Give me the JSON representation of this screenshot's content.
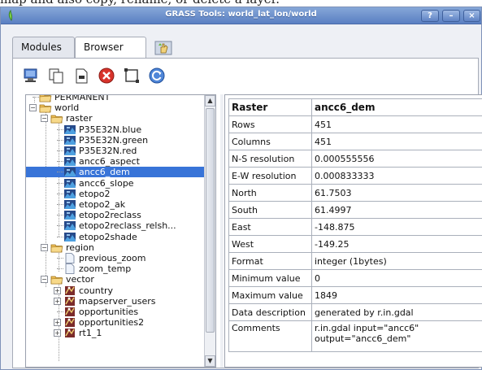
{
  "caption": "map and also copy, rename, or delete a layer.",
  "window": {
    "title": "GRASS Tools: world_lat_lon/world",
    "buttons": [
      "?",
      "–",
      "×"
    ]
  },
  "tabs": [
    {
      "label": "Modules",
      "active": false
    },
    {
      "label": "Browser",
      "active": true
    }
  ],
  "toolbar": {
    "icons": [
      "open-in-qgis-icon",
      "copy-map-icon",
      "rename-map-icon",
      "delete-map-icon",
      "set-region-icon",
      "refresh-icon"
    ]
  },
  "tree": {
    "nodes": [
      {
        "label": "PERMANENT",
        "level": 0,
        "icon": "folder",
        "expander": "none"
      },
      {
        "label": "world",
        "level": 0,
        "icon": "folder",
        "expander": "minus"
      },
      {
        "label": "raster",
        "level": 1,
        "icon": "folder",
        "expander": "minus"
      },
      {
        "label": "P35E32N.blue",
        "level": 2,
        "icon": "raster"
      },
      {
        "label": "P35E32N.green",
        "level": 2,
        "icon": "raster"
      },
      {
        "label": "P35E32N.red",
        "level": 2,
        "icon": "raster"
      },
      {
        "label": "ancc6_aspect",
        "level": 2,
        "icon": "raster"
      },
      {
        "label": "ancc6_dem",
        "level": 2,
        "icon": "raster",
        "selected": true
      },
      {
        "label": "ancc6_slope",
        "level": 2,
        "icon": "raster"
      },
      {
        "label": "etopo2",
        "level": 2,
        "icon": "raster"
      },
      {
        "label": "etopo2_ak",
        "level": 2,
        "icon": "raster"
      },
      {
        "label": "etopo2reclass",
        "level": 2,
        "icon": "raster"
      },
      {
        "label": "etopo2reclass_relsh...",
        "level": 2,
        "icon": "raster"
      },
      {
        "label": "etopo2shade",
        "level": 2,
        "icon": "raster"
      },
      {
        "label": "region",
        "level": 1,
        "icon": "folder",
        "expander": "minus"
      },
      {
        "label": "previous_zoom",
        "level": 2,
        "icon": "file"
      },
      {
        "label": "zoom_temp",
        "level": 2,
        "icon": "file"
      },
      {
        "label": "vector",
        "level": 1,
        "icon": "folder",
        "expander": "minus"
      },
      {
        "label": "country",
        "level": 2,
        "icon": "vector",
        "expander": "plus"
      },
      {
        "label": "mapserver_users",
        "level": 2,
        "icon": "vector",
        "expander": "plus"
      },
      {
        "label": "opportunities",
        "level": 2,
        "icon": "vector"
      },
      {
        "label": "opportunities2",
        "level": 2,
        "icon": "vector",
        "expander": "plus"
      },
      {
        "label": "rt1_1",
        "level": 2,
        "icon": "vector",
        "expander": "plus"
      }
    ]
  },
  "info": {
    "header": {
      "key": "Raster",
      "value": "ancc6_dem"
    },
    "rows": [
      {
        "key": "Rows",
        "value": "451"
      },
      {
        "key": "Columns",
        "value": "451"
      },
      {
        "key": "N-S resolution",
        "value": "0.000555556"
      },
      {
        "key": "E-W resolution",
        "value": "0.000833333"
      },
      {
        "key": "North",
        "value": "61.7503"
      },
      {
        "key": "South",
        "value": "61.4997"
      },
      {
        "key": "East",
        "value": "-148.875"
      },
      {
        "key": "West",
        "value": "-149.25"
      },
      {
        "key": "Format",
        "value": "integer (1bytes)"
      },
      {
        "key": "Minimum value",
        "value": "0"
      },
      {
        "key": "Maximum value",
        "value": "1849"
      },
      {
        "key": "Data description",
        "value": "generated by r.in.gdal"
      },
      {
        "key": "Comments",
        "value": "r.in.gdal input=\"ancc6\"\noutput=\"ancc6_dem\""
      }
    ]
  },
  "colors": {
    "title_bar": "#5a7fc2",
    "selection": "#3874d8",
    "folder": "#e8b54a",
    "delete": "#d8332b"
  }
}
